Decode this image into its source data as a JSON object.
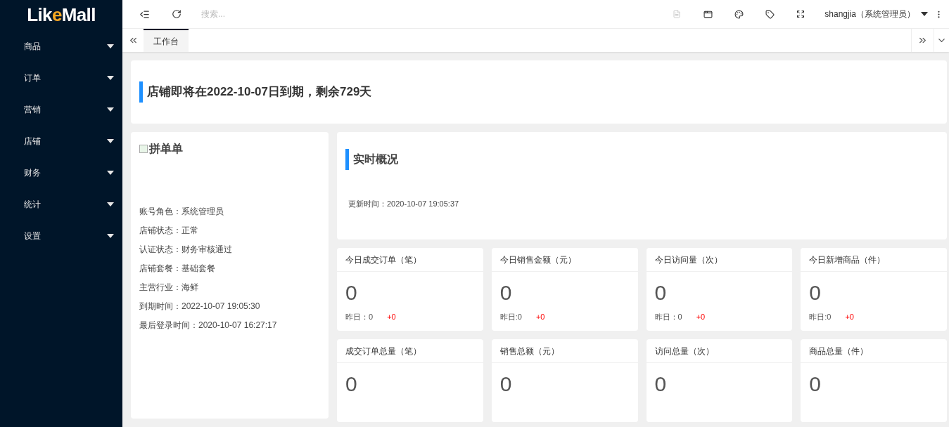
{
  "logo": {
    "before": "Lik",
    "accent": "e",
    "after": "Mall"
  },
  "sidebar": {
    "items": [
      {
        "label": "商品",
        "expanded": false
      },
      {
        "label": "订单",
        "expanded": false
      },
      {
        "label": "营销",
        "expanded": false
      },
      {
        "label": "店铺",
        "expanded": false
      },
      {
        "label": "财务",
        "expanded": false
      },
      {
        "label": "统计",
        "expanded": false
      },
      {
        "label": "设置",
        "expanded": false
      }
    ]
  },
  "header": {
    "search": {
      "placeholder": "搜索..."
    },
    "user": "shangjia（系统管理员）"
  },
  "tabs": [
    {
      "label": "工作台",
      "selected": true
    }
  ],
  "notice": "店铺即将在**2022-10-07**日到期，剩余**729**天",
  "shop": {
    "name": "拼单单",
    "fields": [
      {
        "label": "账号角色：",
        "value": "系统管理员"
      },
      {
        "label": "店铺状态：",
        "value": "正常"
      },
      {
        "label": "认证状态：",
        "value": "财务审核通过"
      },
      {
        "label": "店铺套餐：",
        "value": "基础套餐"
      },
      {
        "label": "主营行业：",
        "value": "海鲜"
      },
      {
        "label": "到期时间：",
        "value": "2022-10-07 19:05:30"
      },
      {
        "label": "最后登录时间：",
        "value": "2020-10-07 16:27:17"
      }
    ]
  },
  "realtime": {
    "title": "实时概况",
    "updated": "更新时间：2020-10-07 19:05:37"
  },
  "today_stats": [
    {
      "title": "今日成交订单（笔）",
      "value": "0",
      "yesterday": "昨日：0",
      "delta": "+0"
    },
    {
      "title": "今日销售金额（元）",
      "value": "0",
      "yesterday": "昨日:0",
      "delta": "+0"
    },
    {
      "title": "今日访问量（次）",
      "value": "0",
      "yesterday": "昨日：0",
      "delta": "+0"
    },
    {
      "title": "今日新增商品（件）",
      "value": "0",
      "yesterday": "昨日:0",
      "delta": "+0"
    }
  ],
  "total_stats": [
    {
      "title": "成交订单总量（笔）",
      "value": "0"
    },
    {
      "title": "销售总额（元）",
      "value": "0"
    },
    {
      "title": "访问总量（次）",
      "value": "0"
    },
    {
      "title": "商品总量（件）",
      "value": "0"
    }
  ]
}
